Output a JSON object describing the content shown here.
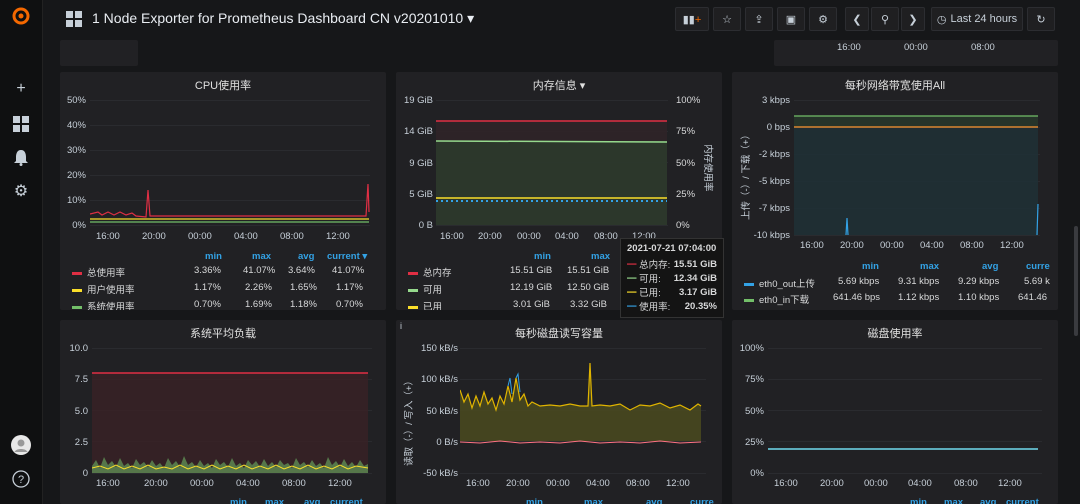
{
  "topbar": {
    "title": "1 Node Exporter for Prometheus Dashboard CN v20201010",
    "time_range": "Last 24 hours",
    "timeline_ticks": [
      "16:00",
      "00:00",
      "08:00"
    ]
  },
  "panels": {
    "cpu": {
      "title": "CPU使用率",
      "y_ticks": [
        "50%",
        "40%",
        "30%",
        "20%",
        "10%",
        "0%"
      ],
      "x_ticks": [
        "16:00",
        "20:00",
        "00:00",
        "04:00",
        "08:00",
        "12:00"
      ],
      "legend_headers": [
        "min",
        "max",
        "avg",
        "current"
      ],
      "legend": [
        {
          "name": "总使用率",
          "color": "#e02f44",
          "values": [
            "3.36%",
            "41.07%",
            "3.64%",
            "41.07%"
          ]
        },
        {
          "name": "用户使用率",
          "color": "#fade2a",
          "values": [
            "1.17%",
            "2.26%",
            "1.65%",
            "1.17%"
          ]
        },
        {
          "name": "系统使用率",
          "color": "#73bf69",
          "values": [
            "0.70%",
            "1.69%",
            "1.18%",
            "0.70%"
          ]
        }
      ]
    },
    "memory": {
      "title": "内存信息",
      "y_ticks": [
        "19 GiB",
        "14 GiB",
        "9 GiB",
        "5 GiB",
        "0 B"
      ],
      "y2_ticks": [
        "100%",
        "75%",
        "50%",
        "25%",
        "0%"
      ],
      "y2_label": "内存使用率",
      "x_ticks": [
        "16:00",
        "20:00",
        "00:00",
        "04:00",
        "08:00",
        "12:00"
      ],
      "legend_headers": [
        "min",
        "max"
      ],
      "legend": [
        {
          "name": "总内存",
          "color": "#e02f44",
          "values": [
            "15.51 GiB",
            "15.51 GiB"
          ]
        },
        {
          "name": "可用",
          "color": "#96d98d",
          "values": [
            "12.19 GiB",
            "12.50 GiB"
          ]
        },
        {
          "name": "已用",
          "color": "#fade2a",
          "values": [
            "3.01 GiB",
            "3.32 GiB"
          ]
        }
      ],
      "tooltip": {
        "time": "2021-07-21 07:04:00",
        "rows": [
          {
            "name": "总内存:",
            "color": "#e02f44",
            "value": "15.51 GiB"
          },
          {
            "name": "可用:",
            "color": "#96d98d",
            "value": "12.34 GiB"
          },
          {
            "name": "已用:",
            "color": "#fade2a",
            "value": "3.17 GiB"
          },
          {
            "name": "使用率:",
            "color": "#33a2e5",
            "value": "20.35%"
          }
        ]
      }
    },
    "network": {
      "title": "每秒网络带宽使用All",
      "y_ticks": [
        "3 kbps",
        "0 bps",
        "-2 kbps",
        "-5 kbps",
        "-7 kbps",
        "-10 kbps"
      ],
      "y_label": "上传（-）/ 下载（+）",
      "x_ticks": [
        "16:00",
        "20:00",
        "00:00",
        "04:00",
        "08:00",
        "12:00"
      ],
      "legend_headers": [
        "min",
        "max",
        "avg",
        "curre"
      ],
      "legend": [
        {
          "name": "eth0_out上传",
          "color": "#33a2e5",
          "values": [
            "5.69 kbps",
            "9.31 kbps",
            "9.29 kbps",
            "5.69 k"
          ]
        },
        {
          "name": "eth0_in下载",
          "color": "#73bf69",
          "values": [
            "641.46 bps",
            "1.12 kbps",
            "1.10 kbps",
            "641.46"
          ]
        }
      ]
    },
    "load": {
      "title": "系统平均负载",
      "y_ticks": [
        "10.0",
        "7.5",
        "5.0",
        "2.5",
        "0"
      ],
      "x_ticks": [
        "16:00",
        "20:00",
        "00:00",
        "04:00",
        "08:00",
        "12:00"
      ],
      "legend_headers": [
        "min",
        "max",
        "avg",
        "current"
      ]
    },
    "disk_io": {
      "title": "每秒磁盘读写容量",
      "y_ticks": [
        "150 kB/s",
        "100 kB/s",
        "50 kB/s",
        "0 B/s",
        "-50 kB/s"
      ],
      "y_label": "读取（-）/ 写入（+）",
      "x_ticks": [
        "16:00",
        "20:00",
        "00:00",
        "04:00",
        "08:00",
        "12:00"
      ],
      "legend_headers": [
        "min",
        "max",
        "avg",
        "curre"
      ]
    },
    "disk_usage": {
      "title": "磁盘使用率",
      "y_ticks": [
        "100%",
        "75%",
        "50%",
        "25%",
        "0%"
      ],
      "x_ticks": [
        "16:00",
        "20:00",
        "00:00",
        "04:00",
        "08:00",
        "12:00"
      ],
      "legend_headers": [
        "min",
        "max",
        "avg",
        "current"
      ]
    }
  },
  "colors": {
    "background": "#161719",
    "panel": "#212124",
    "accent": "#33a2e5",
    "red": "#e02f44",
    "green": "#73bf69",
    "yellow": "#fade2a"
  }
}
